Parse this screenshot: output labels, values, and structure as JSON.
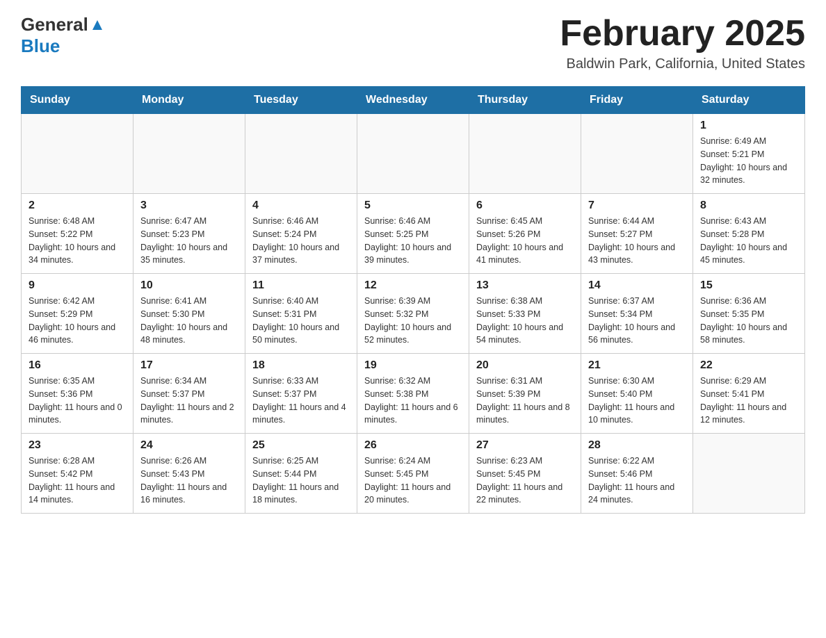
{
  "header": {
    "logo_general": "General",
    "logo_blue": "Blue",
    "month_title": "February 2025",
    "location": "Baldwin Park, California, United States"
  },
  "days_of_week": [
    "Sunday",
    "Monday",
    "Tuesday",
    "Wednesday",
    "Thursday",
    "Friday",
    "Saturday"
  ],
  "weeks": [
    [
      {
        "day": "",
        "sunrise": "",
        "sunset": "",
        "daylight": ""
      },
      {
        "day": "",
        "sunrise": "",
        "sunset": "",
        "daylight": ""
      },
      {
        "day": "",
        "sunrise": "",
        "sunset": "",
        "daylight": ""
      },
      {
        "day": "",
        "sunrise": "",
        "sunset": "",
        "daylight": ""
      },
      {
        "day": "",
        "sunrise": "",
        "sunset": "",
        "daylight": ""
      },
      {
        "day": "",
        "sunrise": "",
        "sunset": "",
        "daylight": ""
      },
      {
        "day": "1",
        "sunrise": "Sunrise: 6:49 AM",
        "sunset": "Sunset: 5:21 PM",
        "daylight": "Daylight: 10 hours and 32 minutes."
      }
    ],
    [
      {
        "day": "2",
        "sunrise": "Sunrise: 6:48 AM",
        "sunset": "Sunset: 5:22 PM",
        "daylight": "Daylight: 10 hours and 34 minutes."
      },
      {
        "day": "3",
        "sunrise": "Sunrise: 6:47 AM",
        "sunset": "Sunset: 5:23 PM",
        "daylight": "Daylight: 10 hours and 35 minutes."
      },
      {
        "day": "4",
        "sunrise": "Sunrise: 6:46 AM",
        "sunset": "Sunset: 5:24 PM",
        "daylight": "Daylight: 10 hours and 37 minutes."
      },
      {
        "day": "5",
        "sunrise": "Sunrise: 6:46 AM",
        "sunset": "Sunset: 5:25 PM",
        "daylight": "Daylight: 10 hours and 39 minutes."
      },
      {
        "day": "6",
        "sunrise": "Sunrise: 6:45 AM",
        "sunset": "Sunset: 5:26 PM",
        "daylight": "Daylight: 10 hours and 41 minutes."
      },
      {
        "day": "7",
        "sunrise": "Sunrise: 6:44 AM",
        "sunset": "Sunset: 5:27 PM",
        "daylight": "Daylight: 10 hours and 43 minutes."
      },
      {
        "day": "8",
        "sunrise": "Sunrise: 6:43 AM",
        "sunset": "Sunset: 5:28 PM",
        "daylight": "Daylight: 10 hours and 45 minutes."
      }
    ],
    [
      {
        "day": "9",
        "sunrise": "Sunrise: 6:42 AM",
        "sunset": "Sunset: 5:29 PM",
        "daylight": "Daylight: 10 hours and 46 minutes."
      },
      {
        "day": "10",
        "sunrise": "Sunrise: 6:41 AM",
        "sunset": "Sunset: 5:30 PM",
        "daylight": "Daylight: 10 hours and 48 minutes."
      },
      {
        "day": "11",
        "sunrise": "Sunrise: 6:40 AM",
        "sunset": "Sunset: 5:31 PM",
        "daylight": "Daylight: 10 hours and 50 minutes."
      },
      {
        "day": "12",
        "sunrise": "Sunrise: 6:39 AM",
        "sunset": "Sunset: 5:32 PM",
        "daylight": "Daylight: 10 hours and 52 minutes."
      },
      {
        "day": "13",
        "sunrise": "Sunrise: 6:38 AM",
        "sunset": "Sunset: 5:33 PM",
        "daylight": "Daylight: 10 hours and 54 minutes."
      },
      {
        "day": "14",
        "sunrise": "Sunrise: 6:37 AM",
        "sunset": "Sunset: 5:34 PM",
        "daylight": "Daylight: 10 hours and 56 minutes."
      },
      {
        "day": "15",
        "sunrise": "Sunrise: 6:36 AM",
        "sunset": "Sunset: 5:35 PM",
        "daylight": "Daylight: 10 hours and 58 minutes."
      }
    ],
    [
      {
        "day": "16",
        "sunrise": "Sunrise: 6:35 AM",
        "sunset": "Sunset: 5:36 PM",
        "daylight": "Daylight: 11 hours and 0 minutes."
      },
      {
        "day": "17",
        "sunrise": "Sunrise: 6:34 AM",
        "sunset": "Sunset: 5:37 PM",
        "daylight": "Daylight: 11 hours and 2 minutes."
      },
      {
        "day": "18",
        "sunrise": "Sunrise: 6:33 AM",
        "sunset": "Sunset: 5:37 PM",
        "daylight": "Daylight: 11 hours and 4 minutes."
      },
      {
        "day": "19",
        "sunrise": "Sunrise: 6:32 AM",
        "sunset": "Sunset: 5:38 PM",
        "daylight": "Daylight: 11 hours and 6 minutes."
      },
      {
        "day": "20",
        "sunrise": "Sunrise: 6:31 AM",
        "sunset": "Sunset: 5:39 PM",
        "daylight": "Daylight: 11 hours and 8 minutes."
      },
      {
        "day": "21",
        "sunrise": "Sunrise: 6:30 AM",
        "sunset": "Sunset: 5:40 PM",
        "daylight": "Daylight: 11 hours and 10 minutes."
      },
      {
        "day": "22",
        "sunrise": "Sunrise: 6:29 AM",
        "sunset": "Sunset: 5:41 PM",
        "daylight": "Daylight: 11 hours and 12 minutes."
      }
    ],
    [
      {
        "day": "23",
        "sunrise": "Sunrise: 6:28 AM",
        "sunset": "Sunset: 5:42 PM",
        "daylight": "Daylight: 11 hours and 14 minutes."
      },
      {
        "day": "24",
        "sunrise": "Sunrise: 6:26 AM",
        "sunset": "Sunset: 5:43 PM",
        "daylight": "Daylight: 11 hours and 16 minutes."
      },
      {
        "day": "25",
        "sunrise": "Sunrise: 6:25 AM",
        "sunset": "Sunset: 5:44 PM",
        "daylight": "Daylight: 11 hours and 18 minutes."
      },
      {
        "day": "26",
        "sunrise": "Sunrise: 6:24 AM",
        "sunset": "Sunset: 5:45 PM",
        "daylight": "Daylight: 11 hours and 20 minutes."
      },
      {
        "day": "27",
        "sunrise": "Sunrise: 6:23 AM",
        "sunset": "Sunset: 5:45 PM",
        "daylight": "Daylight: 11 hours and 22 minutes."
      },
      {
        "day": "28",
        "sunrise": "Sunrise: 6:22 AM",
        "sunset": "Sunset: 5:46 PM",
        "daylight": "Daylight: 11 hours and 24 minutes."
      },
      {
        "day": "",
        "sunrise": "",
        "sunset": "",
        "daylight": ""
      }
    ]
  ]
}
